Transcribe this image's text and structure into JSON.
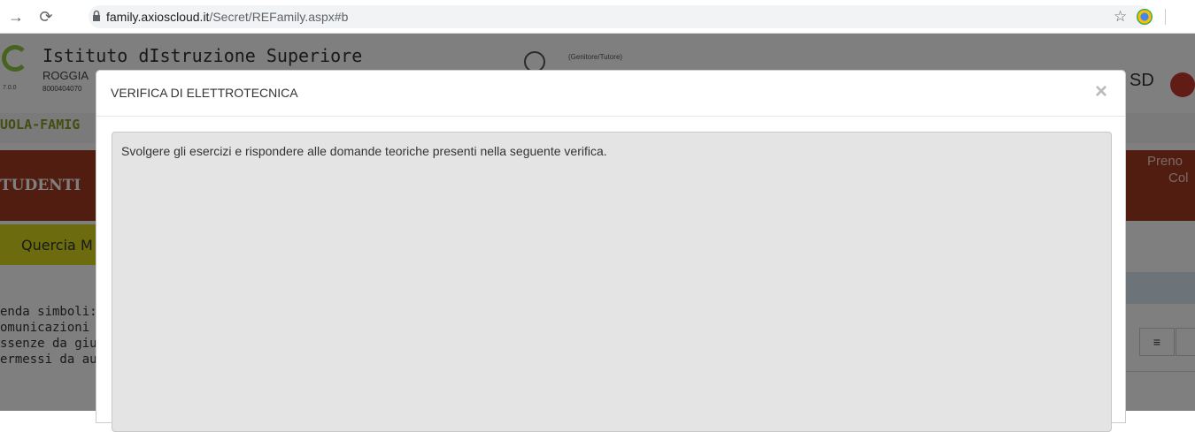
{
  "browser": {
    "back_icon": "arrow-right-icon",
    "url_host": "family.axioscloud.it",
    "url_path": "/Secret/REFamily.aspx#b"
  },
  "header": {
    "version": "7.0.0",
    "school_title": "Istituto dIstruzione Superiore",
    "school_sub": "ROGGIA",
    "school_code": "8000404070",
    "user_role": "(Genitore/Tutore)",
    "sd_logo": "SD"
  },
  "nav": {
    "scuola_label": "UOLA-FAMIG",
    "studenti_label": "TUDENTI",
    "preno_label_1": "Preno",
    "preno_label_2": "Col",
    "student_tab": "Quercia M"
  },
  "legend": {
    "line1": "enda simboli:",
    "line2": "omunicazioni c",
    "line3": "ssenze da giust",
    "line4": "ermessi da aut"
  },
  "modal": {
    "title": "VERIFICA DI ELETTROTECNICA",
    "close_label": "×",
    "body_text": "Svolgere gli esercizi e rispondere alle domande teoriche presenti nella seguente verifica."
  },
  "colors": {
    "brand_green": "#8dc63f",
    "header_red": "#a23a22",
    "tab_yellow": "#d8d81e"
  }
}
